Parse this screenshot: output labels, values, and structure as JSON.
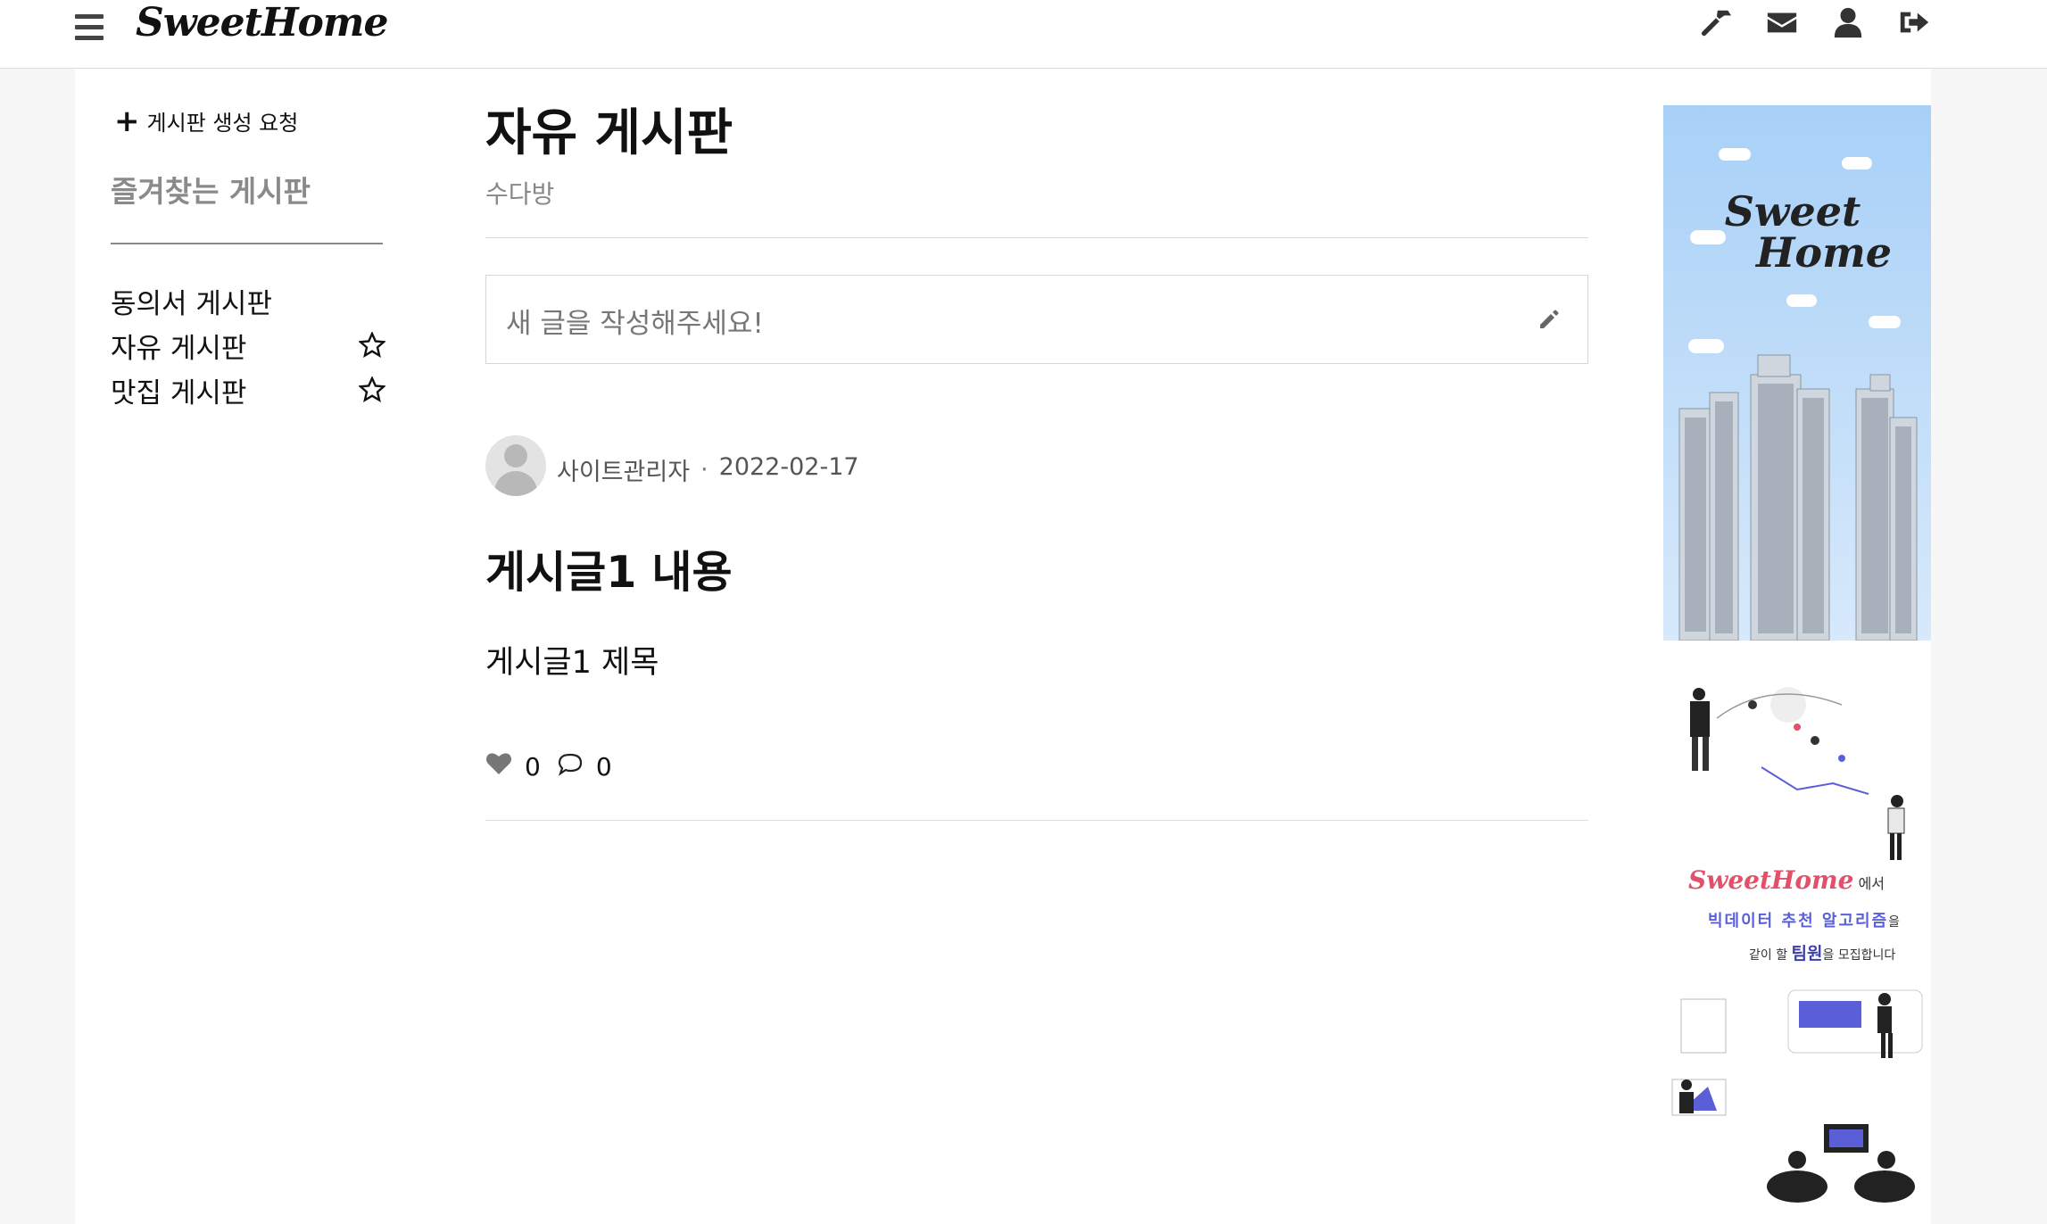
{
  "app": {
    "brand": "SweetHome"
  },
  "nav": {
    "icons": [
      "hammer-icon",
      "envelope-icon",
      "user-icon",
      "sign-out-icon"
    ]
  },
  "sidebar": {
    "create_label": "게시판 생성 요청",
    "favorites_title": "즐겨찾는 게시판",
    "boards": [
      {
        "label": "동의서 게시판",
        "starred": false,
        "show_star": false
      },
      {
        "label": "자유 게시판",
        "starred": false,
        "show_star": true
      },
      {
        "label": "맛집 게시판",
        "starred": false,
        "show_star": true
      }
    ]
  },
  "board": {
    "title": "자유 게시판",
    "subtitle": "수다방",
    "write_placeholder": "새 글을 작성해주세요!"
  },
  "post": {
    "author": "사이트관리자",
    "separator": "·",
    "date": "2022-02-17",
    "heading": "게시글1 내용",
    "body": "게시글1 제목",
    "likes": "0",
    "comments": "0"
  },
  "ads": {
    "ad1_logo_line1": "Sweet",
    "ad1_logo_line2": "Home",
    "ad2_brand": "SweetHome",
    "ad2_suffix": "에서",
    "ad2_line2": "빅데이터 추천 알고리즘",
    "ad2_line2_suffix": "을",
    "ad2_line3_pre": "같이 할 ",
    "ad2_line3_bold": "팀원",
    "ad2_line3_post": "을 모집합니다",
    "colors": {
      "sky": "#a8d0f7",
      "brand_pink": "#e2506a",
      "purple": "#5a5fd8"
    }
  }
}
